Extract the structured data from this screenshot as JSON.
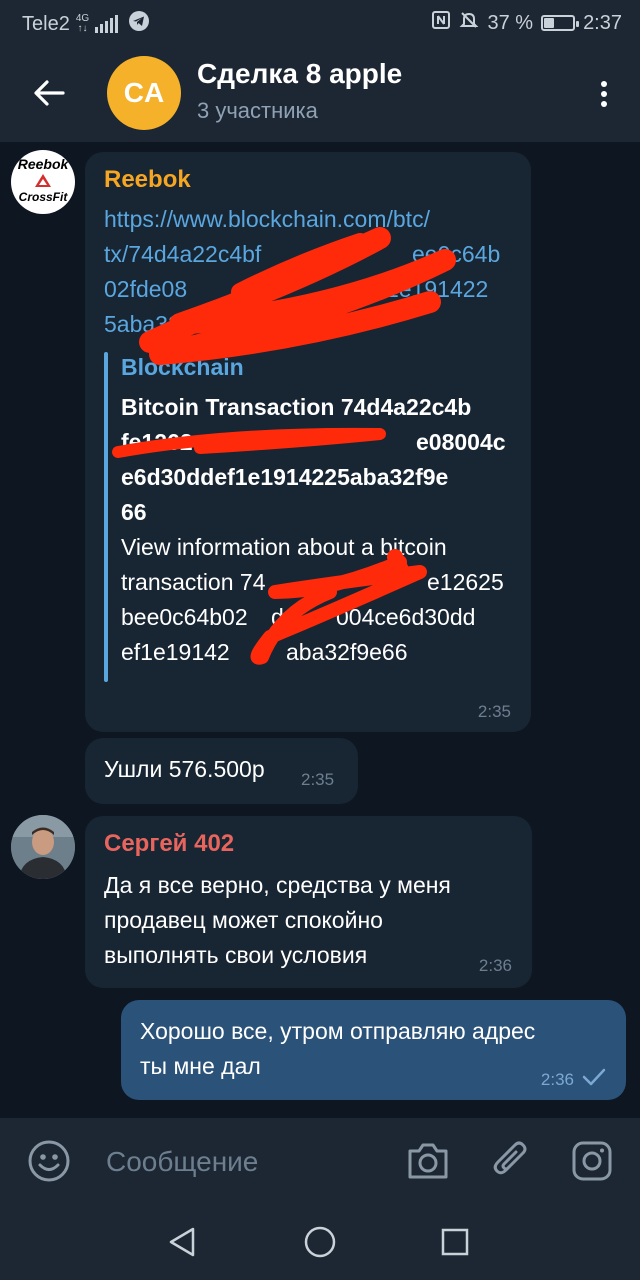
{
  "status_bar": {
    "carrier": "Tele2",
    "net_top": "4G",
    "net_bottom": "↑↓",
    "battery_percent": "37 %",
    "battery_level": 0.37,
    "time": "2:37"
  },
  "header": {
    "avatar_initials": "CA",
    "title": "Сделка 8 apple",
    "subtitle": "3 участника",
    "avatar_color": "#f5b12a"
  },
  "messages": [
    {
      "sender": "Reebok",
      "sender_color": "#f5a623",
      "avatar_lines": [
        "Reebok",
        "CrossFit"
      ],
      "link_lines": [
        "https://www.blockchain.com/btc/",
        "tx/74d4a22c4bf",
        "02fde08",
        "5aba32f9"
      ],
      "link_right_fragments": [
        "ee0c64b",
        "1e191422"
      ],
      "preview": {
        "site": "Blockchain",
        "title_lines": [
          "Bitcoin Transaction 74d4a22c4b",
          "fe1262",
          "e6d30ddef1e1914225aba32f9e",
          "66"
        ],
        "title_right_fragment": "e08004c",
        "desc_lines": [
          "View information about a bitcoin",
          "transaction 74",
          "bee0c64b02",
          "ef1e19142"
        ],
        "desc_right_fragments": [
          "e12625",
          "de",
          "004ce6d30dd",
          "aba32f9e66"
        ]
      },
      "time": "2:35"
    },
    {
      "text": "Ушли 576.500р",
      "time": "2:35"
    },
    {
      "sender": "Сергей 402",
      "sender_color": "#e8655e",
      "text_lines": [
        "Да я все верно, средства у меня",
        "продавец может спокойно",
        "выполнять свои условия"
      ],
      "time": "2:36"
    },
    {
      "outgoing": true,
      "text_lines": [
        "Хорошо все, утром отправляю адрес",
        "ты мне дал"
      ],
      "time": "2:36"
    }
  ],
  "input": {
    "placeholder": "Сообщение"
  },
  "icons": {
    "back": "arrow-left-icon",
    "menu": "more-vertical-icon",
    "emoji": "emoji-icon",
    "camera": "camera-icon",
    "attach": "paperclip-icon",
    "instagram": "instagram-icon"
  },
  "colors": {
    "background": "#0e1621",
    "bar": "#1d2733",
    "bubble_in": "#182533",
    "bubble_out": "#2b5278",
    "link": "#5aa7e0",
    "scribble": "#ff2a0a"
  }
}
